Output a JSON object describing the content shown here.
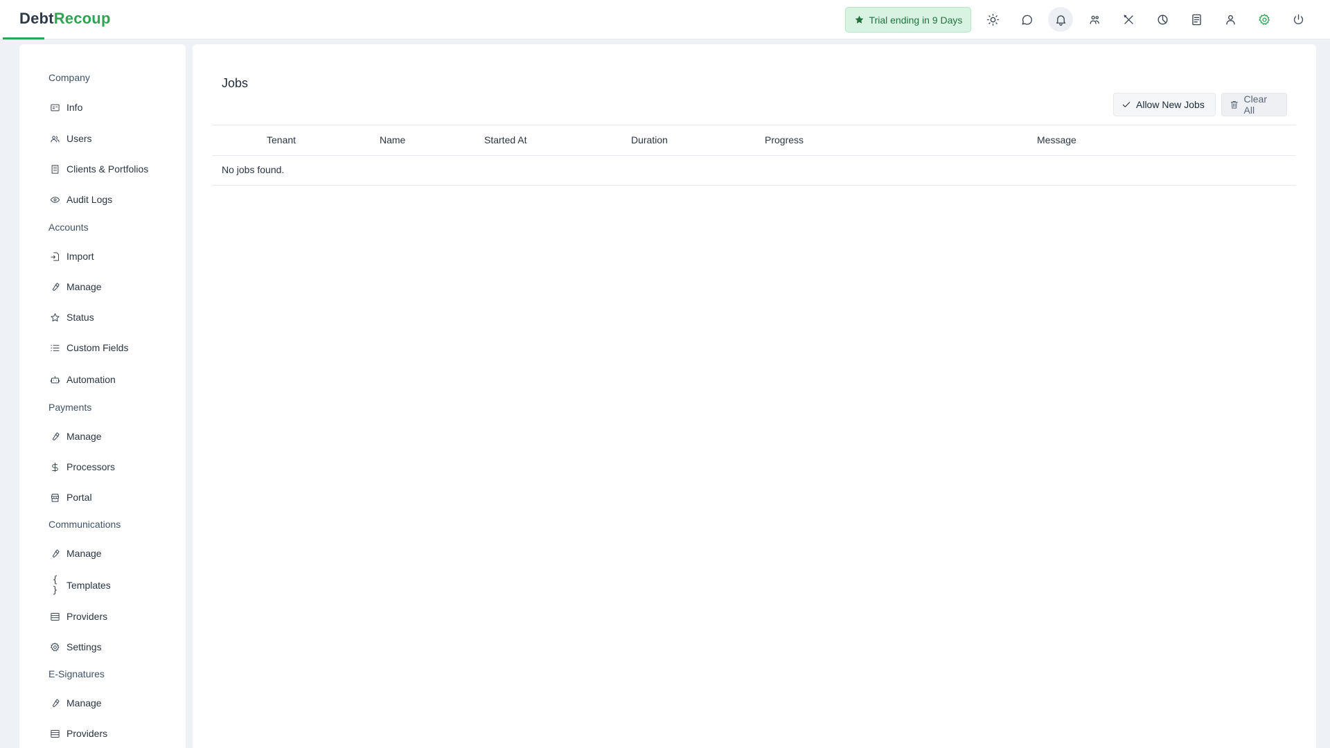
{
  "brand": {
    "part1": "Debt",
    "part2": "Recoup"
  },
  "header": {
    "trial_label": "Trial ending in 9 Days",
    "icons": [
      "sun-icon",
      "chat-icon",
      "bell-icon",
      "team-icon",
      "tools-icon",
      "chart-pie-icon",
      "document-icon",
      "user-icon",
      "gear-icon",
      "power-icon"
    ]
  },
  "sidebar": {
    "company": {
      "title": "Company",
      "items": [
        {
          "label": "Info",
          "icon": "id-card-icon"
        },
        {
          "label": "Users",
          "icon": "users-icon"
        },
        {
          "label": "Clients & Portfolios",
          "icon": "building-icon"
        },
        {
          "label": "Audit Logs",
          "icon": "eye-icon"
        }
      ]
    },
    "accounts": {
      "title": "Accounts",
      "items": [
        {
          "label": "Import",
          "icon": "import-icon"
        },
        {
          "label": "Manage",
          "icon": "wrench-icon"
        },
        {
          "label": "Status",
          "icon": "star-icon"
        },
        {
          "label": "Custom Fields",
          "icon": "list-icon"
        },
        {
          "label": "Automation",
          "icon": "robot-icon"
        }
      ]
    },
    "payments": {
      "title": "Payments",
      "items": [
        {
          "label": "Manage",
          "icon": "wrench-icon"
        },
        {
          "label": "Processors",
          "icon": "dollar-icon"
        },
        {
          "label": "Portal",
          "icon": "store-icon"
        }
      ]
    },
    "communications": {
      "title": "Communications",
      "items": [
        {
          "label": "Manage",
          "icon": "wrench-icon"
        },
        {
          "label": "Templates",
          "icon": "braces-icon",
          "glyph": "{ }"
        },
        {
          "label": "Providers",
          "icon": "server-icon"
        },
        {
          "label": "Settings",
          "icon": "gear-icon"
        }
      ]
    },
    "esignatures": {
      "title": "E-Signatures",
      "items": [
        {
          "label": "Manage",
          "icon": "wrench-icon"
        },
        {
          "label": "Providers",
          "icon": "server-icon"
        }
      ]
    }
  },
  "main": {
    "title": "Jobs",
    "allow_label": "Allow New Jobs",
    "clear_label": "Clear All",
    "columns": [
      "Tenant",
      "Name",
      "Started At",
      "Duration",
      "Progress",
      "Message"
    ],
    "empty_message": "No jobs found."
  },
  "colors": {
    "accent": "#2ea352",
    "trial_bg": "#d8f3e1",
    "page_bg": "#eef1f6"
  }
}
